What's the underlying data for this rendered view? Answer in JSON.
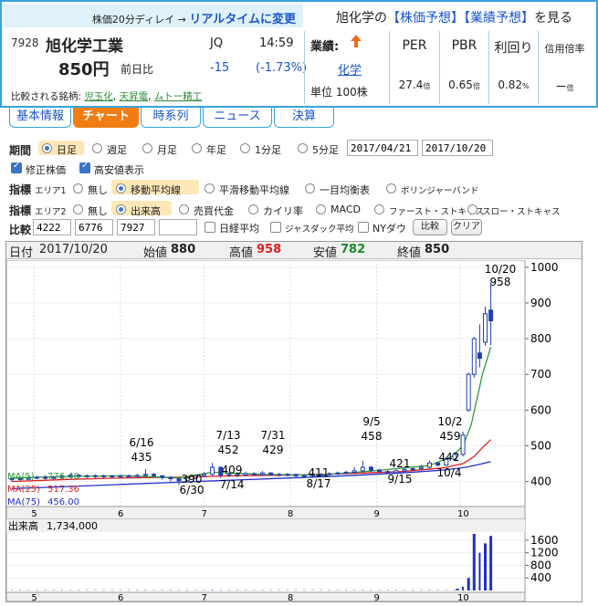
{
  "header": {
    "delay_text": "株価20分ディレイ →",
    "realtime_link": "リアルタイムに変更",
    "predict_prefix": "旭化学の",
    "predict_link1": "【株価予想】",
    "predict_link2": "【業績予想】",
    "predict_suffix": "を見る"
  },
  "stock": {
    "code": "7928",
    "name": "旭化学工業",
    "market": "JQ",
    "time": "14:59",
    "price": "850円",
    "diff_label": "前日比",
    "diff": "-15",
    "diff_pct": "(-1.73%)",
    "comparison_label": "比較される銘柄:",
    "comparisons": [
      "児玉化",
      "天昇電",
      "ムトー精工"
    ],
    "performance_label": "業績:",
    "sector": "化学",
    "unit": "単位 100株"
  },
  "valuation": [
    {
      "label": "PER",
      "value": "27.4",
      "unit": "倍"
    },
    {
      "label": "PBR",
      "value": "0.65",
      "unit": "倍"
    },
    {
      "label": "利回り",
      "value": "0.82",
      "unit": "%"
    },
    {
      "label": "信用倍率",
      "value": "ー",
      "unit": "倍"
    }
  ],
  "tabs": [
    "基本情報",
    "チャート",
    "時系列",
    "ニュース",
    "決算"
  ],
  "controls": {
    "period_label": "期間",
    "period_options": [
      "日足",
      "週足",
      "月足",
      "年足",
      "1分足",
      "5分足"
    ],
    "date_from": "2017/04/21",
    "date_to": "2017/10/20",
    "check_adjusted": "修正株価",
    "check_highlow": "高安値表示",
    "indicator_label": "指標",
    "area1_label": "エリア1",
    "area1_options": [
      "無し",
      "移動平均線",
      "平滑移動平均線",
      "一目均衡表",
      "ボリンジャーバンド"
    ],
    "area2_label": "エリア2",
    "area2_options": [
      "無し",
      "出来高",
      "売買代金",
      "カイリ率",
      "MACD",
      "ファースト・ストキャス",
      "スロー・ストキャス"
    ],
    "compare_label": "比較",
    "compare_codes": [
      "4222",
      "6776",
      "7927",
      ""
    ],
    "compare_checks": [
      "日経平均",
      "ジャスダック平均",
      "NYダウ"
    ],
    "compare_button": "比較",
    "clear_button": "クリア"
  },
  "info": {
    "date_label": "日付",
    "date": "2017/10/20",
    "open_label": "始値",
    "open": "880",
    "high_label": "高値",
    "high": "958",
    "low_label": "安値",
    "low": "782",
    "close_label": "終値",
    "close": "850"
  },
  "ma_legend": [
    {
      "label": "MA(5)",
      "value": "776.40",
      "color": "#2e9a3a"
    },
    {
      "label": "MA(25)",
      "value": "517.36",
      "color": "#e02020"
    },
    {
      "label": "MA(75)",
      "value": "456.00",
      "color": "#2030d0"
    }
  ],
  "volume_label": "出来高",
  "volume_value": "1,734,000",
  "colors": {
    "accent": "#ef7d14",
    "link": "#1a55c9",
    "frame": "#35a4dc",
    "high": "#e02020",
    "low": "#1a8a2a"
  },
  "chart_data": {
    "type": "candlestick",
    "price_axis": {
      "ticks": [
        400,
        500,
        600,
        700,
        800,
        900,
        1000
      ],
      "ylim": [
        330,
        1020
      ]
    },
    "volume_axis": {
      "ticks": [
        400,
        800,
        1200,
        1600
      ],
      "ylim": [
        0,
        1800
      ]
    },
    "month_labels": [
      "5",
      "6",
      "7",
      "8",
      "9",
      "10"
    ],
    "annotations_high": [
      {
        "date": "6/16",
        "value": "435"
      },
      {
        "date": "7/13",
        "value": "452"
      },
      {
        "date": "7/31",
        "value": "429"
      },
      {
        "date": "9/5",
        "value": "458"
      },
      {
        "date": "10/2",
        "value": "459"
      },
      {
        "date": "10/20",
        "value": "958"
      }
    ],
    "annotations_low": [
      {
        "value": "390",
        "date": "6/30"
      },
      {
        "value": "409",
        "date": "7/14"
      },
      {
        "value": "411",
        "date": "8/17"
      },
      {
        "value": "421",
        "date": "9/15"
      },
      {
        "value": "442",
        "date": "10/4"
      }
    ],
    "candles": [
      {
        "d": 0,
        "o": 405,
        "c": 408,
        "h": 410,
        "l": 400
      },
      {
        "d": 3,
        "o": 408,
        "c": 406,
        "h": 412,
        "l": 402
      },
      {
        "d": 6,
        "o": 406,
        "c": 410,
        "h": 414,
        "l": 404
      },
      {
        "d": 9,
        "o": 410,
        "c": 412,
        "h": 416,
        "l": 406
      },
      {
        "d": 12,
        "o": 412,
        "c": 409,
        "h": 418,
        "l": 405
      },
      {
        "d": 15,
        "o": 409,
        "c": 412,
        "h": 416,
        "l": 406
      },
      {
        "d": 18,
        "o": 412,
        "c": 415,
        "h": 420,
        "l": 408
      },
      {
        "d": 21,
        "o": 415,
        "c": 418,
        "h": 422,
        "l": 410
      },
      {
        "d": 24,
        "o": 418,
        "c": 415,
        "h": 420,
        "l": 410
      },
      {
        "d": 27,
        "o": 415,
        "c": 416,
        "h": 420,
        "l": 410
      },
      {
        "d": 30,
        "o": 416,
        "c": 414,
        "h": 420,
        "l": 410
      },
      {
        "d": 33,
        "o": 414,
        "c": 416,
        "h": 420,
        "l": 408
      },
      {
        "d": 36,
        "o": 416,
        "c": 413,
        "h": 418,
        "l": 408
      },
      {
        "d": 39,
        "o": 413,
        "c": 416,
        "h": 420,
        "l": 410
      },
      {
        "d": 42,
        "o": 416,
        "c": 414,
        "h": 420,
        "l": 410
      },
      {
        "d": 45,
        "o": 414,
        "c": 417,
        "h": 422,
        "l": 410
      },
      {
        "d": 48,
        "o": 417,
        "c": 420,
        "h": 435,
        "l": 412
      },
      {
        "d": 51,
        "o": 420,
        "c": 416,
        "h": 424,
        "l": 412
      },
      {
        "d": 54,
        "o": 416,
        "c": 412,
        "h": 418,
        "l": 405
      },
      {
        "d": 57,
        "o": 412,
        "c": 408,
        "h": 414,
        "l": 400
      },
      {
        "d": 60,
        "o": 408,
        "c": 402,
        "h": 410,
        "l": 390
      },
      {
        "d": 63,
        "o": 402,
        "c": 410,
        "h": 414,
        "l": 398
      },
      {
        "d": 66,
        "o": 410,
        "c": 416,
        "h": 420,
        "l": 406
      },
      {
        "d": 69,
        "o": 416,
        "c": 420,
        "h": 426,
        "l": 412
      },
      {
        "d": 72,
        "o": 420,
        "c": 440,
        "h": 452,
        "l": 416
      },
      {
        "d": 75,
        "o": 440,
        "c": 418,
        "h": 442,
        "l": 409
      },
      {
        "d": 78,
        "o": 418,
        "c": 420,
        "h": 426,
        "l": 412
      },
      {
        "d": 81,
        "o": 420,
        "c": 418,
        "h": 424,
        "l": 412
      },
      {
        "d": 84,
        "o": 418,
        "c": 422,
        "h": 428,
        "l": 414
      },
      {
        "d": 87,
        "o": 422,
        "c": 420,
        "h": 426,
        "l": 416
      },
      {
        "d": 90,
        "o": 420,
        "c": 424,
        "h": 429,
        "l": 416
      },
      {
        "d": 93,
        "o": 424,
        "c": 420,
        "h": 426,
        "l": 416
      },
      {
        "d": 96,
        "o": 420,
        "c": 418,
        "h": 424,
        "l": 414
      },
      {
        "d": 99,
        "o": 418,
        "c": 420,
        "h": 424,
        "l": 414
      },
      {
        "d": 102,
        "o": 420,
        "c": 416,
        "h": 422,
        "l": 412
      },
      {
        "d": 105,
        "o": 416,
        "c": 414,
        "h": 420,
        "l": 411
      },
      {
        "d": 108,
        "o": 414,
        "c": 418,
        "h": 422,
        "l": 412
      },
      {
        "d": 111,
        "o": 418,
        "c": 420,
        "h": 424,
        "l": 414
      },
      {
        "d": 114,
        "o": 420,
        "c": 422,
        "h": 426,
        "l": 416
      },
      {
        "d": 117,
        "o": 422,
        "c": 424,
        "h": 428,
        "l": 418
      },
      {
        "d": 120,
        "o": 424,
        "c": 426,
        "h": 430,
        "l": 420
      },
      {
        "d": 123,
        "o": 426,
        "c": 430,
        "h": 440,
        "l": 422
      },
      {
        "d": 126,
        "o": 430,
        "c": 440,
        "h": 458,
        "l": 426
      },
      {
        "d": 129,
        "o": 440,
        "c": 432,
        "h": 444,
        "l": 426
      },
      {
        "d": 132,
        "o": 432,
        "c": 428,
        "h": 436,
        "l": 424
      },
      {
        "d": 135,
        "o": 428,
        "c": 425,
        "h": 432,
        "l": 421
      },
      {
        "d": 138,
        "o": 425,
        "c": 430,
        "h": 434,
        "l": 422
      },
      {
        "d": 141,
        "o": 430,
        "c": 434,
        "h": 438,
        "l": 426
      },
      {
        "d": 144,
        "o": 434,
        "c": 436,
        "h": 440,
        "l": 430
      },
      {
        "d": 147,
        "o": 436,
        "c": 440,
        "h": 446,
        "l": 432
      },
      {
        "d": 150,
        "o": 440,
        "c": 452,
        "h": 459,
        "l": 436
      },
      {
        "d": 153,
        "o": 452,
        "c": 446,
        "h": 454,
        "l": 442
      },
      {
        "d": 156,
        "o": 446,
        "c": 462,
        "h": 468,
        "l": 444
      },
      {
        "d": 159,
        "o": 462,
        "c": 476,
        "h": 482,
        "l": 458
      },
      {
        "d": 162,
        "o": 476,
        "c": 530,
        "h": 540,
        "l": 470
      },
      {
        "d": 164,
        "o": 600,
        "c": 700,
        "h": 705,
        "l": 595
      },
      {
        "d": 166,
        "o": 700,
        "c": 800,
        "h": 805,
        "l": 690
      },
      {
        "d": 168,
        "o": 760,
        "c": 745,
        "h": 840,
        "l": 720
      },
      {
        "d": 170,
        "o": 790,
        "c": 870,
        "h": 890,
        "l": 780
      },
      {
        "d": 172,
        "o": 880,
        "c": 850,
        "h": 958,
        "l": 782
      }
    ],
    "ma5": [
      [
        0,
        410
      ],
      [
        20,
        414
      ],
      [
        40,
        416
      ],
      [
        60,
        410
      ],
      [
        72,
        426
      ],
      [
        90,
        420
      ],
      [
        110,
        418
      ],
      [
        130,
        430
      ],
      [
        150,
        445
      ],
      [
        158,
        470
      ],
      [
        162,
        500
      ],
      [
        165,
        560
      ],
      [
        167,
        630
      ],
      [
        169,
        700
      ],
      [
        172,
        776.4
      ]
    ],
    "ma25": [
      [
        0,
        400
      ],
      [
        20,
        406
      ],
      [
        40,
        410
      ],
      [
        60,
        412
      ],
      [
        80,
        416
      ],
      [
        100,
        418
      ],
      [
        120,
        422
      ],
      [
        140,
        428
      ],
      [
        155,
        438
      ],
      [
        162,
        450
      ],
      [
        166,
        470
      ],
      [
        169,
        495
      ],
      [
        172,
        517.36
      ]
    ],
    "ma75": [
      [
        0,
        380
      ],
      [
        20,
        386
      ],
      [
        40,
        392
      ],
      [
        60,
        398
      ],
      [
        80,
        404
      ],
      [
        100,
        410
      ],
      [
        120,
        416
      ],
      [
        140,
        424
      ],
      [
        155,
        432
      ],
      [
        163,
        440
      ],
      [
        168,
        448
      ],
      [
        172,
        456
      ]
    ],
    "volume": [
      {
        "d": 0,
        "v": 10
      },
      {
        "d": 48,
        "v": 15
      },
      {
        "d": 72,
        "v": 20
      },
      {
        "d": 126,
        "v": 15
      },
      {
        "d": 150,
        "v": 15
      },
      {
        "d": 160,
        "v": 60
      },
      {
        "d": 162,
        "v": 120
      },
      {
        "d": 164,
        "v": 400
      },
      {
        "d": 166,
        "v": 1800
      },
      {
        "d": 168,
        "v": 1200
      },
      {
        "d": 170,
        "v": 1500
      },
      {
        "d": 172,
        "v": 1734
      }
    ]
  }
}
